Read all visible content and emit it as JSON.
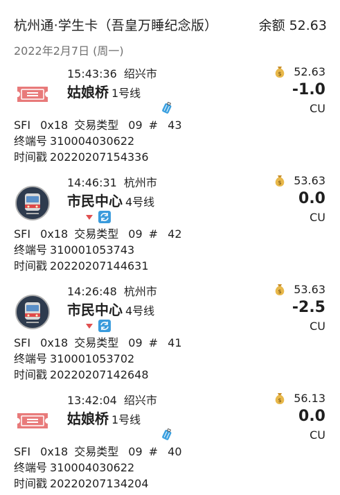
{
  "header": {
    "card_title": "杭州通·学生卡（吾皇万睡纪念版）",
    "balance_label": "余额",
    "balance_value": "52.63"
  },
  "date": "2022年2月7日 (周一)",
  "labels": {
    "sfi": "SFI",
    "type": "交易类型",
    "hash": "#",
    "terminal": "终端号",
    "timestamp": "时间戳"
  },
  "colors": {
    "ticket": "#e87a7a",
    "subway_face": "#2e3b4e",
    "subway_ring": "#b0b0b0",
    "down_arrow": "#e05050",
    "transfer_bg": "#3a9bdc",
    "luggage": "#3aa0e0",
    "money_bag": "#e8b84a"
  },
  "transactions": [
    {
      "icon": "ticket-icon",
      "time": "15:43:36",
      "city": "绍兴市",
      "station": "姑娘桥",
      "line": "1号线",
      "marker": "luggage-icon",
      "balance_after": "52.63",
      "amount": "-1.0",
      "unit": "CU",
      "sfi": "0x18",
      "type": "09",
      "seq": "43",
      "terminal": "310004030622",
      "timestamp": "20220207154336"
    },
    {
      "icon": "subway-icon",
      "time": "14:46:31",
      "city": "杭州市",
      "station": "市民中心",
      "line": "4号线",
      "marker": "transfer-icon",
      "balance_after": "53.63",
      "amount": "0.0",
      "unit": "CU",
      "sfi": "0x18",
      "type": "09",
      "seq": "42",
      "terminal": "310001053743",
      "timestamp": "20220207144631"
    },
    {
      "icon": "subway-icon",
      "time": "14:26:48",
      "city": "杭州市",
      "station": "市民中心",
      "line": "4号线",
      "marker": "transfer-icon",
      "balance_after": "53.63",
      "amount": "-2.5",
      "unit": "CU",
      "sfi": "0x18",
      "type": "09",
      "seq": "41",
      "terminal": "310001053702",
      "timestamp": "20220207142648"
    },
    {
      "icon": "ticket-icon",
      "time": "13:42:04",
      "city": "绍兴市",
      "station": "姑娘桥",
      "line": "1号线",
      "marker": "luggage-icon",
      "balance_after": "56.13",
      "amount": "0.0",
      "unit": "CU",
      "sfi": "0x18",
      "type": "09",
      "seq": "40",
      "terminal": "310004030622",
      "timestamp": "20220207134204"
    }
  ]
}
